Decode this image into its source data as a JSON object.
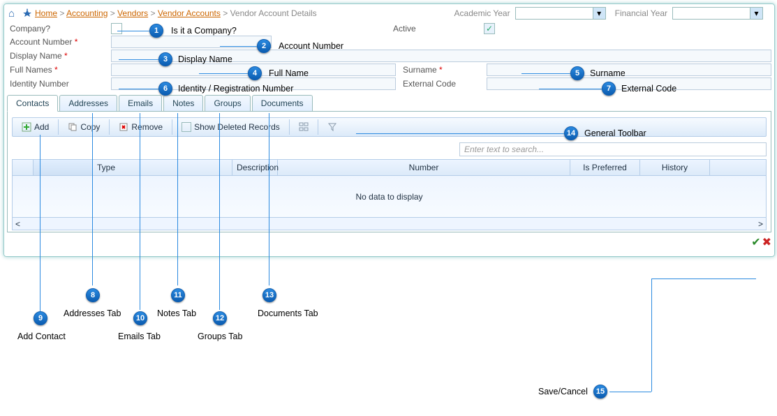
{
  "breadcrumb": [
    "Home",
    "Accounting",
    "Vendors",
    "Vendor Accounts",
    "Vendor Account Details"
  ],
  "yearLabels": {
    "academic": "Academic Year",
    "financial": "Financial Year"
  },
  "form": {
    "company_label": "Company?",
    "active_label": "Active",
    "account_no_label": "Account Number",
    "display_name_label": "Display Name",
    "full_names_label": "Full Names",
    "surname_label": "Surname",
    "identity_label": "Identity Number",
    "external_label": "External Code"
  },
  "tabs": [
    "Contacts",
    "Addresses",
    "Emails",
    "Notes",
    "Groups",
    "Documents"
  ],
  "toolbar": {
    "add": "Add",
    "copy": "Copy",
    "remove": "Remove",
    "show_deleted": "Show Deleted Records"
  },
  "search_placeholder": "Enter text to search...",
  "grid_cols": [
    "",
    "Type",
    "Description",
    "Number",
    "Is Preferred",
    "History"
  ],
  "grid_empty": "No data to display",
  "callouts": {
    "1": "Is it a Company?",
    "2": "Account Number",
    "3": "Display Name",
    "4": "Full Name",
    "5": "Surname",
    "6": "Identity / Registration Number",
    "7": "External Code",
    "8": "Addresses Tab",
    "9": "Add Contact",
    "10": "Emails Tab",
    "11": "Notes Tab",
    "12": "Groups Tab",
    "13": "Documents Tab",
    "14": "General Toolbar",
    "15": "Save/Cancel"
  }
}
